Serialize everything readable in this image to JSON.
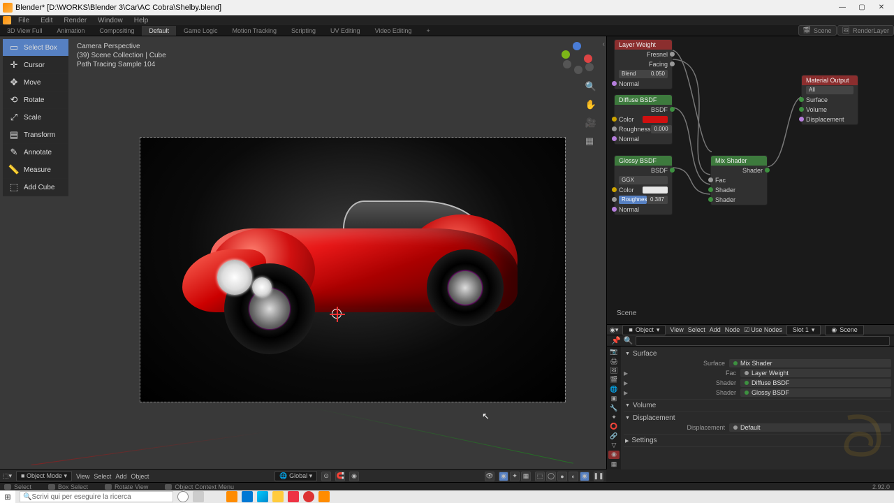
{
  "title": "Blender* [D:\\WORKS\\Blender 3\\Car\\AC Cobra\\Shelby.blend]",
  "menubar": [
    "File",
    "Edit",
    "Render",
    "Window",
    "Help"
  ],
  "workspaces": {
    "tabs": [
      "3D View Full",
      "Animation",
      "Compositing",
      "Default",
      "Game Logic",
      "Motion Tracking",
      "Scripting",
      "UV Editing",
      "Video Editing",
      "+"
    ],
    "active": "Default"
  },
  "header": {
    "scene_label": "Scene",
    "layer_label": "RenderLayer"
  },
  "tools": [
    {
      "icon": "▭",
      "label": "Select Box",
      "active": true
    },
    {
      "icon": "✛",
      "label": "Cursor"
    },
    {
      "icon": "✥",
      "label": "Move"
    },
    {
      "icon": "⟲",
      "label": "Rotate"
    },
    {
      "icon": "⤢",
      "label": "Scale"
    },
    {
      "icon": "▤",
      "label": "Transform"
    },
    {
      "icon": "✎",
      "label": "Annotate"
    },
    {
      "icon": "📏",
      "label": "Measure"
    },
    {
      "icon": "⬚",
      "label": "Add Cube"
    }
  ],
  "vpinfo": {
    "l1": "Camera Perspective",
    "l2": "(39) Scene Collection | Cube",
    "l3": "Path Tracing Sample 104"
  },
  "nodes": {
    "layer_weight": {
      "title": "Layer Weight",
      "fresnel": "Fresnel",
      "facing": "Facing",
      "blend_l": "Blend",
      "blend_v": "0.050",
      "normal": "Normal"
    },
    "diffuse": {
      "title": "Diffuse BSDF",
      "out": "BSDF",
      "color": "Color",
      "rough_l": "Roughness",
      "rough_v": "0.000",
      "normal": "Normal"
    },
    "glossy": {
      "title": "Glossy BSDF",
      "out": "BSDF",
      "dist": "GGX",
      "color": "Color",
      "rough_l": "Roughness",
      "rough_v": "0.387",
      "normal": "Normal"
    },
    "mix": {
      "title": "Mix Shader",
      "out": "Shader",
      "fac": "Fac",
      "s1": "Shader",
      "s2": "Shader"
    },
    "matout": {
      "title": "Material Output",
      "target": "All",
      "surface": "Surface",
      "volume": "Volume",
      "disp": "Displacement"
    }
  },
  "scene_lbl": "Scene",
  "propheader": {
    "obj": "Object",
    "view": "View",
    "select": "Select",
    "add": "Add",
    "node": "Node",
    "usenodes": "Use Nodes",
    "slot": "Slot 1",
    "scene": "Scene"
  },
  "propsearch_placeholder": "",
  "surface_section": "Surface",
  "props": [
    {
      "label": "Surface",
      "value": "Mix Shader",
      "t": "sh"
    },
    {
      "label": "Fac",
      "value": "Layer Weight",
      "t": "in",
      "exp": true
    },
    {
      "label": "Shader",
      "value": "Diffuse BSDF",
      "t": "sh",
      "exp": true
    },
    {
      "label": "Shader",
      "value": "Glossy BSDF",
      "t": "sh",
      "exp": true
    }
  ],
  "volume_section": "Volume",
  "disp_section": "Displacement",
  "disp": {
    "label": "Displacement",
    "value": "Default"
  },
  "settings_section": "Settings",
  "bottombar": {
    "mode": "Object Mode",
    "view": "View",
    "select": "Select",
    "add": "Add",
    "object": "Object",
    "orient": "Global"
  },
  "status": {
    "s1": "Select",
    "s2": "Box Select",
    "s3": "Rotate View",
    "s4": "Object Context Menu",
    "version": "2.92.0"
  },
  "taskbar": {
    "search": "Scrivi qui per eseguire la ricerca"
  }
}
